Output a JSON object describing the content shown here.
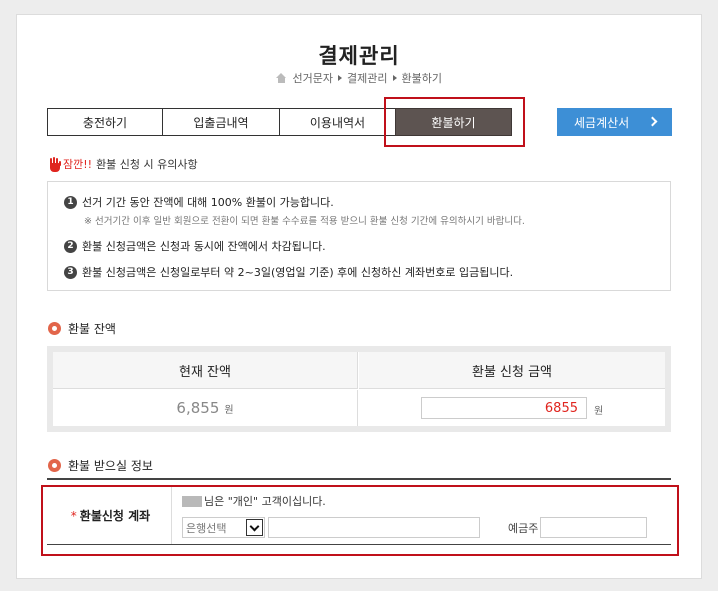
{
  "header": {
    "title": "결제관리",
    "breadcrumb": [
      "선거문자",
      "결제관리",
      "환불하기"
    ]
  },
  "tabs": [
    {
      "label": "충전하기",
      "active": false
    },
    {
      "label": "입출금내역",
      "active": false
    },
    {
      "label": "이용내역서",
      "active": false
    },
    {
      "label": "환불하기",
      "active": true
    }
  ],
  "tax_button": {
    "label": "세금계산서"
  },
  "caution": {
    "warn": "잠깐!!",
    "title": "환불 신청 시 유의사항"
  },
  "notices": [
    {
      "num": "1",
      "text": "선거 기간 동안 잔액에 대해 100% 환불이 가능합니다.",
      "sub": "※ 선거기간 이후 일반 회원으로 전환이 되면 환불 수수료를 적용 받으니 환불 신청 기간에 유의하시기 바랍니다."
    },
    {
      "num": "2",
      "text": "환불 신청금액은 신청과 동시에 잔액에서 차감됩니다."
    },
    {
      "num": "3",
      "text": "환불 신청금액은 신청일로부터 약 2~3일(영업일 기준) 후에 신청하신 계좌번호로 입금됩니다."
    }
  ],
  "balance_section": {
    "title": "환불 잔액",
    "current_header": "현재 잔액",
    "request_header": "환불 신청 금액",
    "current_amount": "6,855",
    "request_amount": "6855",
    "unit": "원"
  },
  "account_section": {
    "title": "환불 받으실 정보",
    "required_mark": "*",
    "label": "환불신청 계좌",
    "owner_text": "님은 \"개인\" 고객이십니다.",
    "bank_select": "은행선택",
    "account_number": "",
    "holder_label": "예금주",
    "holder_value": ""
  },
  "colors": {
    "accent_blue": "#3d8fd6",
    "active_tab": "#5d5451",
    "highlight_red": "#c0101a",
    "warning_red": "#e0251f"
  }
}
